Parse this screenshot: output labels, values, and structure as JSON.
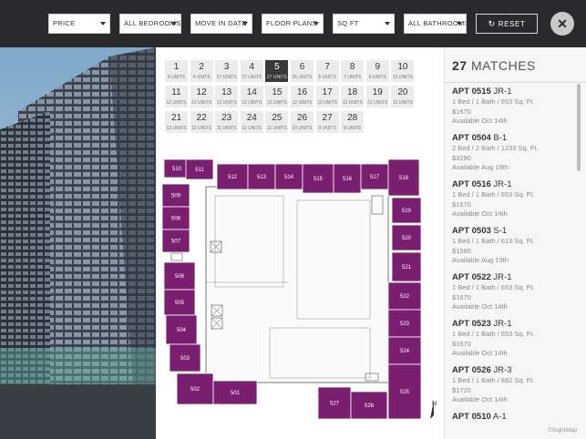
{
  "filters": [
    {
      "label": "PRICE"
    },
    {
      "label": "ALL BEDROOMS"
    },
    {
      "label": "MOVE IN DATE"
    },
    {
      "label": "FLOOR PLANS"
    },
    {
      "label": "SQ FT"
    },
    {
      "label": "ALL BATHROOMS"
    }
  ],
  "reset_label": "RESET",
  "close_label": "✕",
  "days": [
    {
      "n": "1",
      "u": "9 UNITS"
    },
    {
      "n": "2",
      "u": "4 UNITS"
    },
    {
      "n": "3",
      "u": "27 UNITS"
    },
    {
      "n": "4",
      "u": "27 UNITS"
    },
    {
      "n": "5",
      "u": "27 UNITS"
    },
    {
      "n": "6",
      "u": "26 UNITS"
    },
    {
      "n": "7",
      "u": "6 UNITS"
    },
    {
      "n": "8",
      "u": "7 UNITS"
    },
    {
      "n": "9",
      "u": "6 UNITS"
    },
    {
      "n": "10",
      "u": "12 UNITS"
    },
    {
      "n": "11",
      "u": "12 UNITS"
    },
    {
      "n": "12",
      "u": "12 UNITS"
    },
    {
      "n": "13",
      "u": "12 UNITS"
    },
    {
      "n": "14",
      "u": "12 UNITS"
    },
    {
      "n": "15",
      "u": "12 UNITS"
    },
    {
      "n": "16",
      "u": "12 UNITS"
    },
    {
      "n": "17",
      "u": "12 UNITS"
    },
    {
      "n": "18",
      "u": "12 UNITS"
    },
    {
      "n": "19",
      "u": "12 UNITS"
    },
    {
      "n": "20",
      "u": "12 UNITS"
    },
    {
      "n": "21",
      "u": "12 UNITS"
    },
    {
      "n": "22",
      "u": "12 UNITS"
    },
    {
      "n": "23",
      "u": "11 UNITS"
    },
    {
      "n": "24",
      "u": "11 UNITS"
    },
    {
      "n": "25",
      "u": "11 UNITS"
    },
    {
      "n": "26",
      "u": "10 UNITS"
    },
    {
      "n": "27",
      "u": "9 UNITS"
    },
    {
      "n": "28",
      "u": "8 UNITS"
    }
  ],
  "selected_day": "5",
  "units": [
    "510",
    "511",
    "512",
    "513",
    "514",
    "515",
    "516",
    "517",
    "518",
    "509",
    "508",
    "507",
    "519",
    "520",
    "521",
    "506",
    "505",
    "504",
    "503",
    "502",
    "501",
    "522",
    "523",
    "524",
    "525",
    "527",
    "526"
  ],
  "north_label": "N",
  "matches": {
    "count": "27",
    "label": "MATCHES"
  },
  "apartments": [
    {
      "apt": "APT 0515",
      "plan": "JR-1",
      "desc": "1 Bed / 1 Bath / 653 Sq. Ft.",
      "price": "$1670",
      "avail": "Available Oct 14th"
    },
    {
      "apt": "APT 0504",
      "plan": "B-1",
      "desc": "2 Bed / 2 Bath / 1233 Sq. Ft.",
      "price": "$3290",
      "avail": "Available Aug 19th"
    },
    {
      "apt": "APT 0516",
      "plan": "JR-1",
      "desc": "1 Bed / 1 Bath / 653 Sq. Ft.",
      "price": "$1670",
      "avail": "Available Oct 14th"
    },
    {
      "apt": "APT 0503",
      "plan": "S-1",
      "desc": "1 Bed / 1 Bath / 613 Sq. Ft.",
      "price": "$1580",
      "avail": "Available Aug 19th"
    },
    {
      "apt": "APT 0522",
      "plan": "JR-1",
      "desc": "1 Bed / 1 Bath / 653 Sq. Ft.",
      "price": "$1670",
      "avail": "Available Oct 14th"
    },
    {
      "apt": "APT 0523",
      "plan": "JR-1",
      "desc": "1 Bed / 1 Bath / 653 Sq. Ft.",
      "price": "$1670",
      "avail": "Available Oct 14th"
    },
    {
      "apt": "APT 0526",
      "plan": "JR-3",
      "desc": "1 Bed / 1 Bath / 682 Sq. Ft.",
      "price": "$1720",
      "avail": "Available Oct 14th"
    },
    {
      "apt": "APT 0510",
      "plan": "A-1",
      "desc": "",
      "price": "",
      "avail": ""
    }
  ],
  "brand": "©SightMap",
  "colors": {
    "unit": "#7a1f6f",
    "topbar": "#2a2a2c",
    "selected_day": "#3a3a3a"
  }
}
